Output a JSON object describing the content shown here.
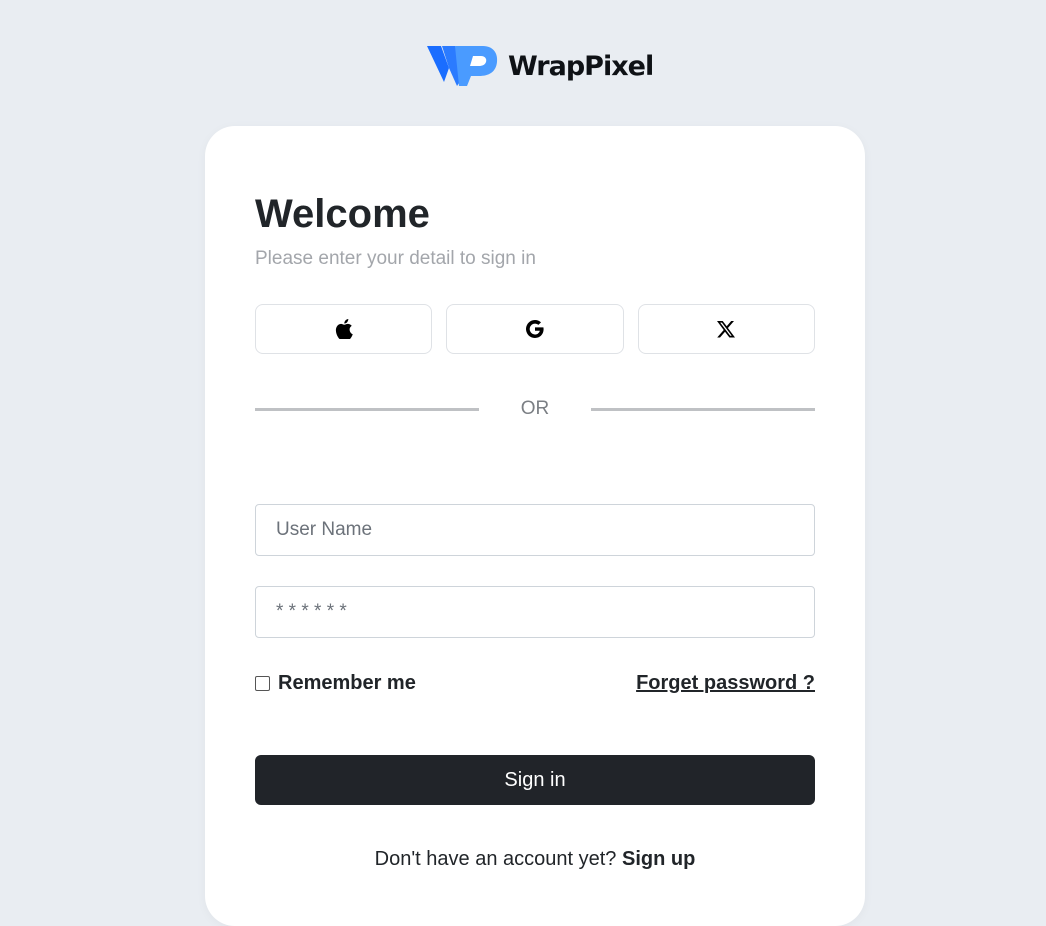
{
  "brand": {
    "name": "WrapPixel",
    "logo_icon": "wrappixel-logo-icon",
    "logo_colors": [
      "#1a6dff",
      "#4a9bff"
    ]
  },
  "card": {
    "title": "Welcome",
    "subtitle": "Please enter your detail to sign in"
  },
  "social": [
    {
      "name": "apple",
      "icon": "apple-icon"
    },
    {
      "name": "google",
      "icon": "google-icon"
    },
    {
      "name": "x",
      "icon": "x-icon"
    }
  ],
  "divider": {
    "label": "OR"
  },
  "form": {
    "username_placeholder": "User Name",
    "username_value": "",
    "password_placeholder": "* * * * * *",
    "password_value": "",
    "remember_label": "Remember me",
    "remember_checked": false,
    "forgot_label": "Forget password ?",
    "submit_label": "Sign in"
  },
  "signup": {
    "prompt": "Don't have an account yet?",
    "link_label": "Sign up"
  },
  "colors": {
    "background": "#e9edf2",
    "card": "#ffffff",
    "primary_button": "#212429",
    "muted_text": "#a3a6ab"
  }
}
